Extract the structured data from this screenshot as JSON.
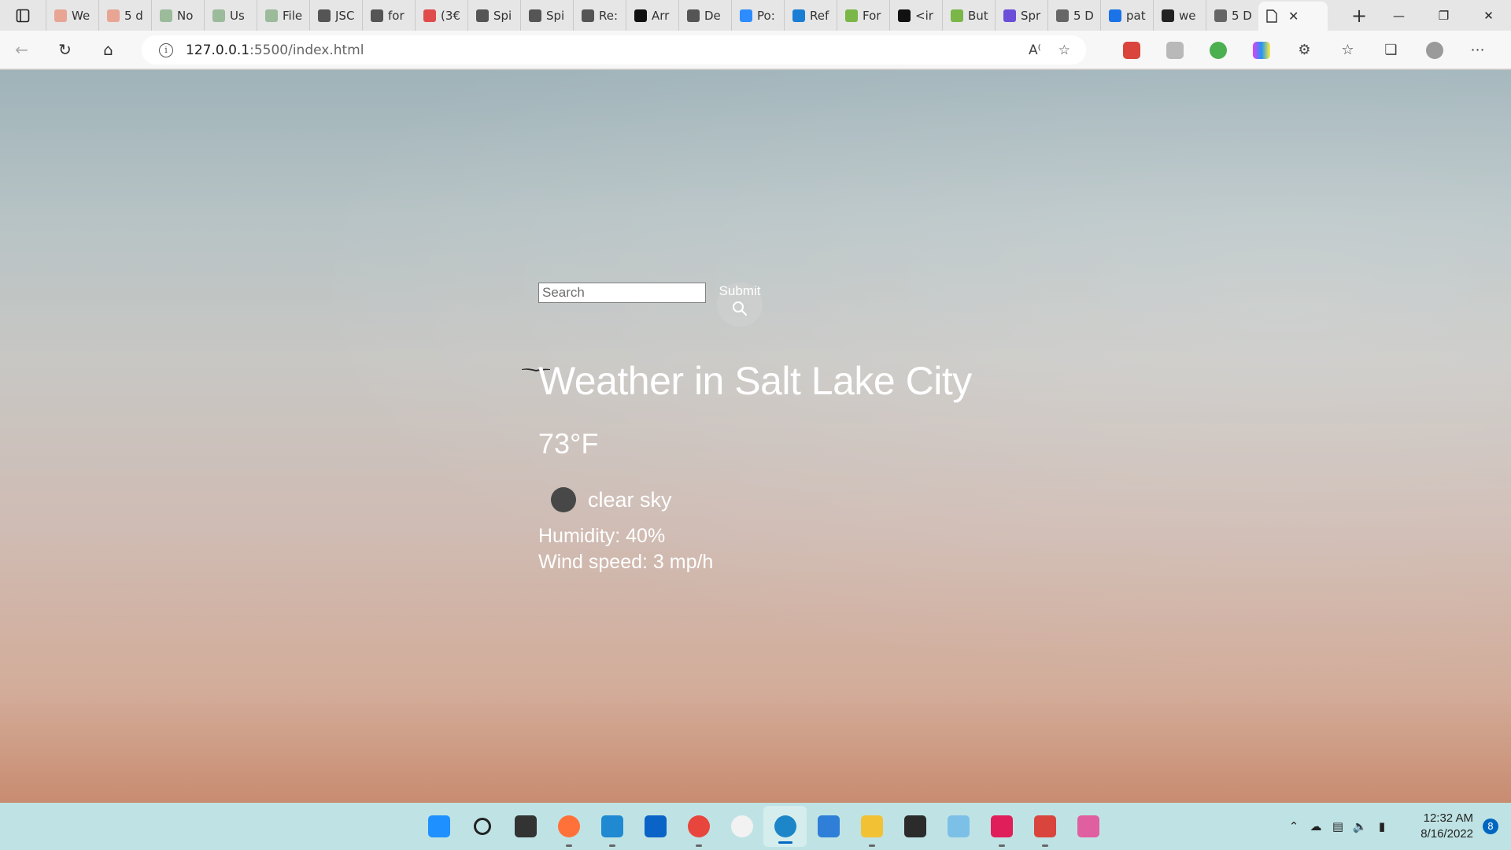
{
  "browser": {
    "tabs": [
      {
        "label": "We",
        "color": "#e8a594"
      },
      {
        "label": "5 d",
        "color": "#e8a594"
      },
      {
        "label": "No",
        "color": "#9bbb9b"
      },
      {
        "label": "Us",
        "color": "#9bbb9b"
      },
      {
        "label": "File",
        "color": "#9bbb9b"
      },
      {
        "label": "JSC",
        "color": "#555555"
      },
      {
        "label": "for",
        "color": "#555555"
      },
      {
        "label": "(3€",
        "color": "#e04c4c"
      },
      {
        "label": "Spi",
        "color": "#555555"
      },
      {
        "label": "Spi",
        "color": "#555555"
      },
      {
        "label": "Re:",
        "color": "#555555"
      },
      {
        "label": "Arr",
        "color": "#111111"
      },
      {
        "label": "De",
        "color": "#555555"
      },
      {
        "label": "Po:",
        "color": "#2d8cff"
      },
      {
        "label": "Ref",
        "color": "#1a7fd4"
      },
      {
        "label": "For",
        "color": "#7ab648"
      },
      {
        "label": "<ir",
        "color": "#111111"
      },
      {
        "label": "But",
        "color": "#7ab648"
      },
      {
        "label": "Spr",
        "color": "#6b4fd8"
      },
      {
        "label": "5 D",
        "color": "#666666"
      },
      {
        "label": "pat",
        "color": "#1a73e8"
      },
      {
        "label": "we",
        "color": "#222222"
      },
      {
        "label": "5 D",
        "color": "#666666"
      }
    ],
    "url_host": "127.0.0.1",
    "url_path": ":5500/index.html"
  },
  "page": {
    "search_placeholder": "Search",
    "submit_label": "Submit",
    "city_title": "Weather in Salt Lake City",
    "temperature": "73°F",
    "description": "clear sky",
    "humidity": "Humidity: 40%",
    "wind": "Wind speed: 3 mp/h"
  },
  "taskbar": {
    "apps": [
      {
        "name": "start-icon",
        "color": "#1e90ff"
      },
      {
        "name": "search-icon",
        "color": "#222222"
      },
      {
        "name": "task-view-icon",
        "color": "#333333"
      },
      {
        "name": "firefox-icon",
        "color": "#ff7139"
      },
      {
        "name": "vscode-icon",
        "color": "#1f8ad2"
      },
      {
        "name": "outlook-icon",
        "color": "#0a64c8"
      },
      {
        "name": "chrome-icon",
        "color": "#e8453c"
      },
      {
        "name": "itunes-icon",
        "color": "#f2f2f2"
      },
      {
        "name": "edge-icon",
        "color": "#1c86c8"
      },
      {
        "name": "notepad-icon",
        "color": "#2f7fd8"
      },
      {
        "name": "file-explorer-icon",
        "color": "#f2c234"
      },
      {
        "name": "terminal-icon",
        "color": "#2b2b2b"
      },
      {
        "name": "git-icon",
        "color": "#7cc0e8"
      },
      {
        "name": "slack-icon",
        "color": "#e01e5a"
      },
      {
        "name": "heroku-icon",
        "color": "#d9453c"
      },
      {
        "name": "snipping-tool-icon",
        "color": "#e05fa0"
      }
    ],
    "time": "12:32 AM",
    "date": "8/16/2022",
    "notifications": "8"
  }
}
